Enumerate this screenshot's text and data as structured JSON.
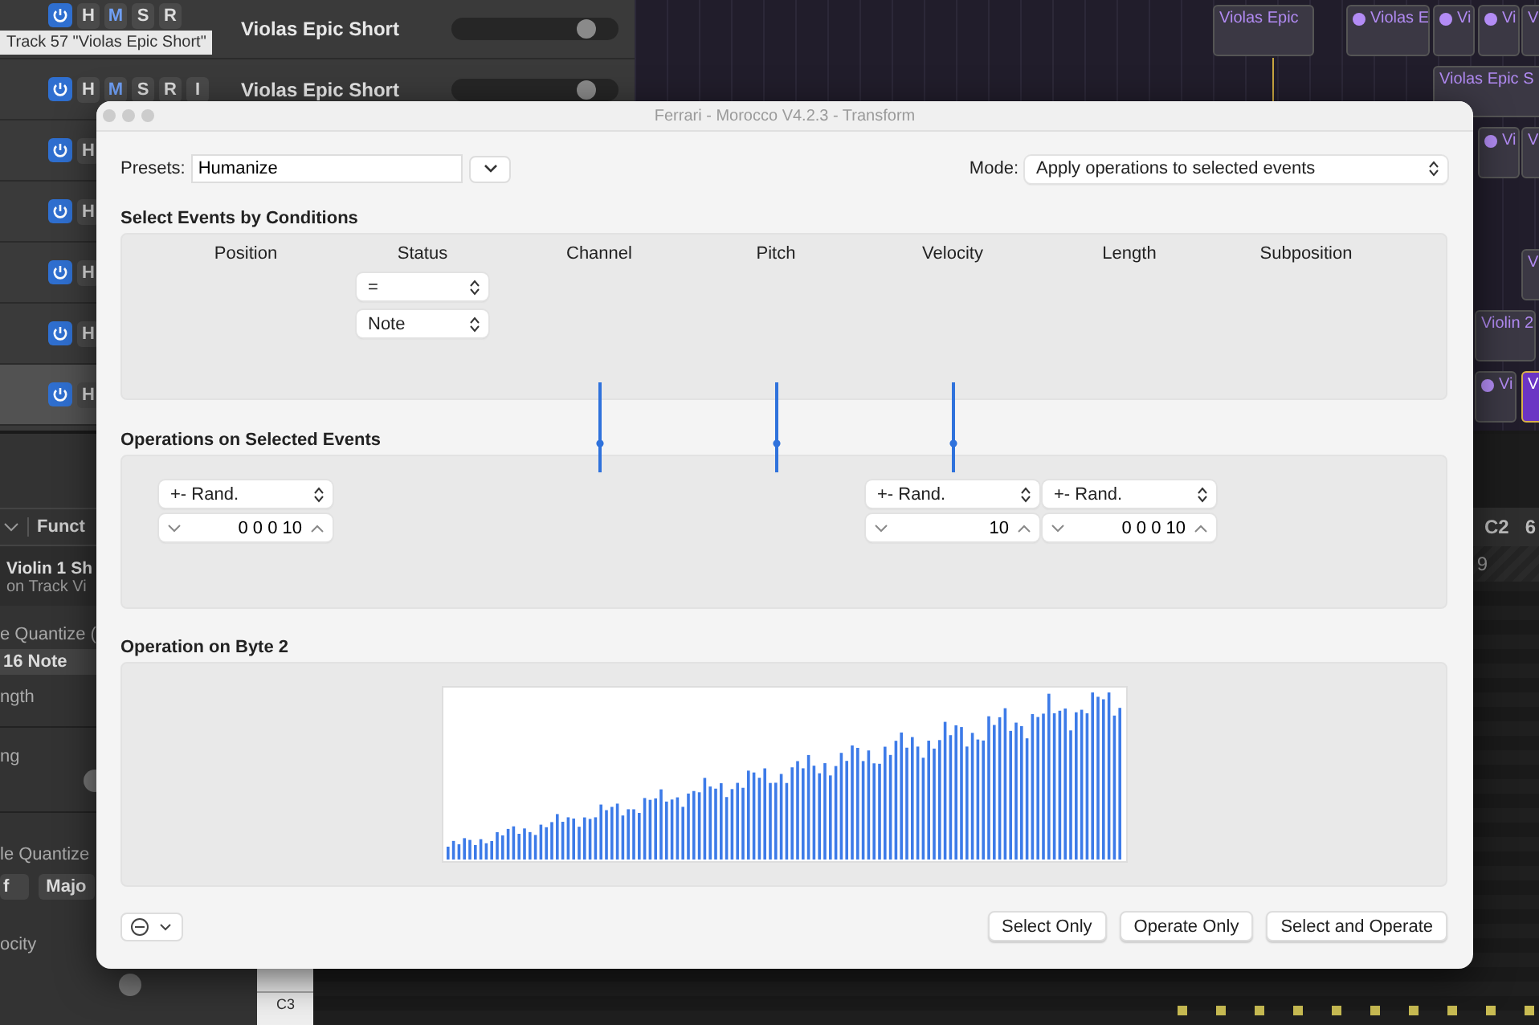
{
  "tracks": [
    {
      "name": "Violas Epic Short",
      "selected": false,
      "power": true,
      "buttons": [
        {
          "label": "H",
          "on": false
        },
        {
          "label": "M",
          "on": true
        },
        {
          "label": "S",
          "on": false
        },
        {
          "label": "R",
          "on": false
        }
      ]
    },
    {
      "name": "Violas Epic Short",
      "selected": false,
      "power": true,
      "buttons": [
        {
          "label": "H",
          "on": false
        },
        {
          "label": "M",
          "on": true
        },
        {
          "label": "S",
          "on": false
        },
        {
          "label": "R",
          "on": false
        },
        {
          "label": "I",
          "on": false
        }
      ]
    },
    {
      "selected": false,
      "power": true,
      "buttons": [
        {
          "label": "H",
          "on": false
        }
      ]
    },
    {
      "selected": false,
      "power": true,
      "buttons": [
        {
          "label": "H",
          "on": false
        }
      ]
    },
    {
      "selected": false,
      "power": true,
      "buttons": [
        {
          "label": "H",
          "on": false
        }
      ]
    },
    {
      "selected": false,
      "power": true,
      "buttons": [
        {
          "label": "H",
          "on": false
        }
      ]
    },
    {
      "selected": true,
      "power": true,
      "buttons": [
        {
          "label": "H",
          "on": false
        }
      ]
    }
  ],
  "tooltip": "Track 57 \"Violas Epic Short\"",
  "regions": [
    {
      "name": "Violas Epic",
      "dot": false,
      "selected": false
    },
    {
      "name": "Violas E",
      "dot": true,
      "selected": false
    },
    {
      "name": "Vi",
      "dot": true,
      "selected": false
    },
    {
      "name": "Vi",
      "dot": true,
      "selected": false
    },
    {
      "name": "V",
      "dot": false,
      "selected": false
    },
    {
      "name": "Violas Epic S",
      "dot": false,
      "selected": false
    },
    {
      "name": "Vi",
      "dot": true,
      "selected": false
    },
    {
      "name": "V",
      "dot": false,
      "selected": false
    },
    {
      "name": "V",
      "dot": false,
      "selected": false
    },
    {
      "name": "Violin 2",
      "dot": false,
      "selected": false
    },
    {
      "name": "Vi",
      "dot": true,
      "selected": false
    },
    {
      "name": "V",
      "dot": false,
      "selected": true
    }
  ],
  "inspector": {
    "menu_label": "Funct",
    "region_name": "Violin 1 Sh",
    "region_track": "on Track Vi",
    "quantize_label": "e Quantize (",
    "quantize_value": "16 Note",
    "length_label": "ngth",
    "swing_label": "ng",
    "scale_label": "le Quantize",
    "scale_value": "f",
    "scale_type": "Majo",
    "velocity_label": "ocity"
  },
  "editor": {
    "header": [
      "C2",
      "6"
    ],
    "ruler": "9",
    "key": "C3"
  },
  "dialog": {
    "title": "Ferrari - Morocco V4.2.3 - Transform",
    "presets_label": "Presets:",
    "preset": "Humanize",
    "mode_label": "Mode:",
    "mode": "Apply operations to selected events",
    "conditions_title": "Select Events by Conditions",
    "columns": [
      {
        "label": "Position",
        "operation": {
          "op": "+- Rand.",
          "value": "0 0 0 10"
        }
      },
      {
        "label": "Status",
        "controls": [
          "=",
          "Note"
        ]
      },
      {
        "label": "Channel",
        "thru": true
      },
      {
        "label": "Pitch",
        "thru": true
      },
      {
        "label": "Velocity",
        "thru": true,
        "operation": {
          "op": "+- Rand.",
          "value": "10"
        }
      },
      {
        "label": "Length",
        "operation": {
          "op": "+- Rand.",
          "value": "0 0 0 10"
        }
      },
      {
        "label": "Subposition"
      }
    ],
    "operations_title": "Operations on Selected Events",
    "byte_title": "Operation on Byte 2",
    "buttons": [
      "Select Only",
      "Operate Only",
      "Select and Operate"
    ]
  }
}
